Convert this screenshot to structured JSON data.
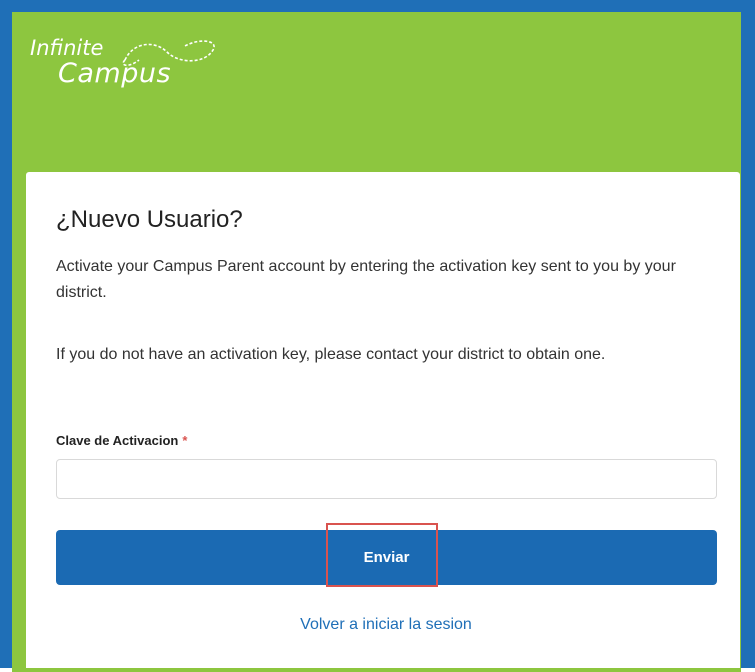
{
  "brand": {
    "line1": "Infinite",
    "line2": "Campus",
    "header_color": "#8dc63f",
    "frame_color": "#1f6fb7"
  },
  "card": {
    "title": "¿Nuevo Usuario?",
    "description1": "Activate your Campus Parent account by entering the activation key sent to you by your district.",
    "description2": "If you do not have an activation key, please contact your district to obtain one.",
    "field_label": "Clave de Activacion",
    "required_marker": "*",
    "activation_key_value": "",
    "submit_label": "Enviar",
    "submit_color": "#1b6ab3",
    "back_link_label": "Volver a iniciar la sesion"
  }
}
